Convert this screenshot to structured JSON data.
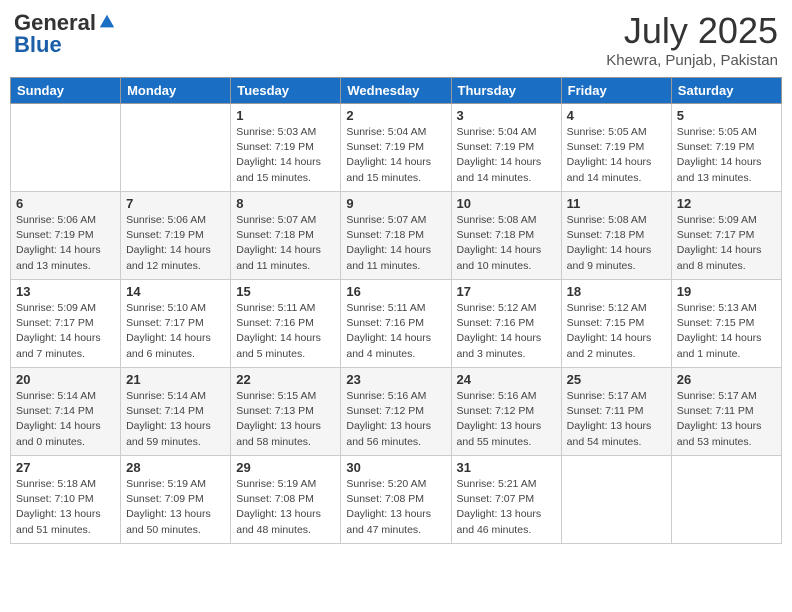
{
  "header": {
    "logo_general": "General",
    "logo_blue": "Blue",
    "title": "July 2025",
    "location": "Khewra, Punjab, Pakistan"
  },
  "calendar": {
    "days_of_week": [
      "Sunday",
      "Monday",
      "Tuesday",
      "Wednesday",
      "Thursday",
      "Friday",
      "Saturday"
    ],
    "weeks": [
      [
        {
          "day": "",
          "info": ""
        },
        {
          "day": "",
          "info": ""
        },
        {
          "day": "1",
          "info": "Sunrise: 5:03 AM\nSunset: 7:19 PM\nDaylight: 14 hours and 15 minutes."
        },
        {
          "day": "2",
          "info": "Sunrise: 5:04 AM\nSunset: 7:19 PM\nDaylight: 14 hours and 15 minutes."
        },
        {
          "day": "3",
          "info": "Sunrise: 5:04 AM\nSunset: 7:19 PM\nDaylight: 14 hours and 14 minutes."
        },
        {
          "day": "4",
          "info": "Sunrise: 5:05 AM\nSunset: 7:19 PM\nDaylight: 14 hours and 14 minutes."
        },
        {
          "day": "5",
          "info": "Sunrise: 5:05 AM\nSunset: 7:19 PM\nDaylight: 14 hours and 13 minutes."
        }
      ],
      [
        {
          "day": "6",
          "info": "Sunrise: 5:06 AM\nSunset: 7:19 PM\nDaylight: 14 hours and 13 minutes."
        },
        {
          "day": "7",
          "info": "Sunrise: 5:06 AM\nSunset: 7:19 PM\nDaylight: 14 hours and 12 minutes."
        },
        {
          "day": "8",
          "info": "Sunrise: 5:07 AM\nSunset: 7:18 PM\nDaylight: 14 hours and 11 minutes."
        },
        {
          "day": "9",
          "info": "Sunrise: 5:07 AM\nSunset: 7:18 PM\nDaylight: 14 hours and 11 minutes."
        },
        {
          "day": "10",
          "info": "Sunrise: 5:08 AM\nSunset: 7:18 PM\nDaylight: 14 hours and 10 minutes."
        },
        {
          "day": "11",
          "info": "Sunrise: 5:08 AM\nSunset: 7:18 PM\nDaylight: 14 hours and 9 minutes."
        },
        {
          "day": "12",
          "info": "Sunrise: 5:09 AM\nSunset: 7:17 PM\nDaylight: 14 hours and 8 minutes."
        }
      ],
      [
        {
          "day": "13",
          "info": "Sunrise: 5:09 AM\nSunset: 7:17 PM\nDaylight: 14 hours and 7 minutes."
        },
        {
          "day": "14",
          "info": "Sunrise: 5:10 AM\nSunset: 7:17 PM\nDaylight: 14 hours and 6 minutes."
        },
        {
          "day": "15",
          "info": "Sunrise: 5:11 AM\nSunset: 7:16 PM\nDaylight: 14 hours and 5 minutes."
        },
        {
          "day": "16",
          "info": "Sunrise: 5:11 AM\nSunset: 7:16 PM\nDaylight: 14 hours and 4 minutes."
        },
        {
          "day": "17",
          "info": "Sunrise: 5:12 AM\nSunset: 7:16 PM\nDaylight: 14 hours and 3 minutes."
        },
        {
          "day": "18",
          "info": "Sunrise: 5:12 AM\nSunset: 7:15 PM\nDaylight: 14 hours and 2 minutes."
        },
        {
          "day": "19",
          "info": "Sunrise: 5:13 AM\nSunset: 7:15 PM\nDaylight: 14 hours and 1 minute."
        }
      ],
      [
        {
          "day": "20",
          "info": "Sunrise: 5:14 AM\nSunset: 7:14 PM\nDaylight: 14 hours and 0 minutes."
        },
        {
          "day": "21",
          "info": "Sunrise: 5:14 AM\nSunset: 7:14 PM\nDaylight: 13 hours and 59 minutes."
        },
        {
          "day": "22",
          "info": "Sunrise: 5:15 AM\nSunset: 7:13 PM\nDaylight: 13 hours and 58 minutes."
        },
        {
          "day": "23",
          "info": "Sunrise: 5:16 AM\nSunset: 7:12 PM\nDaylight: 13 hours and 56 minutes."
        },
        {
          "day": "24",
          "info": "Sunrise: 5:16 AM\nSunset: 7:12 PM\nDaylight: 13 hours and 55 minutes."
        },
        {
          "day": "25",
          "info": "Sunrise: 5:17 AM\nSunset: 7:11 PM\nDaylight: 13 hours and 54 minutes."
        },
        {
          "day": "26",
          "info": "Sunrise: 5:17 AM\nSunset: 7:11 PM\nDaylight: 13 hours and 53 minutes."
        }
      ],
      [
        {
          "day": "27",
          "info": "Sunrise: 5:18 AM\nSunset: 7:10 PM\nDaylight: 13 hours and 51 minutes."
        },
        {
          "day": "28",
          "info": "Sunrise: 5:19 AM\nSunset: 7:09 PM\nDaylight: 13 hours and 50 minutes."
        },
        {
          "day": "29",
          "info": "Sunrise: 5:19 AM\nSunset: 7:08 PM\nDaylight: 13 hours and 48 minutes."
        },
        {
          "day": "30",
          "info": "Sunrise: 5:20 AM\nSunset: 7:08 PM\nDaylight: 13 hours and 47 minutes."
        },
        {
          "day": "31",
          "info": "Sunrise: 5:21 AM\nSunset: 7:07 PM\nDaylight: 13 hours and 46 minutes."
        },
        {
          "day": "",
          "info": ""
        },
        {
          "day": "",
          "info": ""
        }
      ]
    ]
  }
}
